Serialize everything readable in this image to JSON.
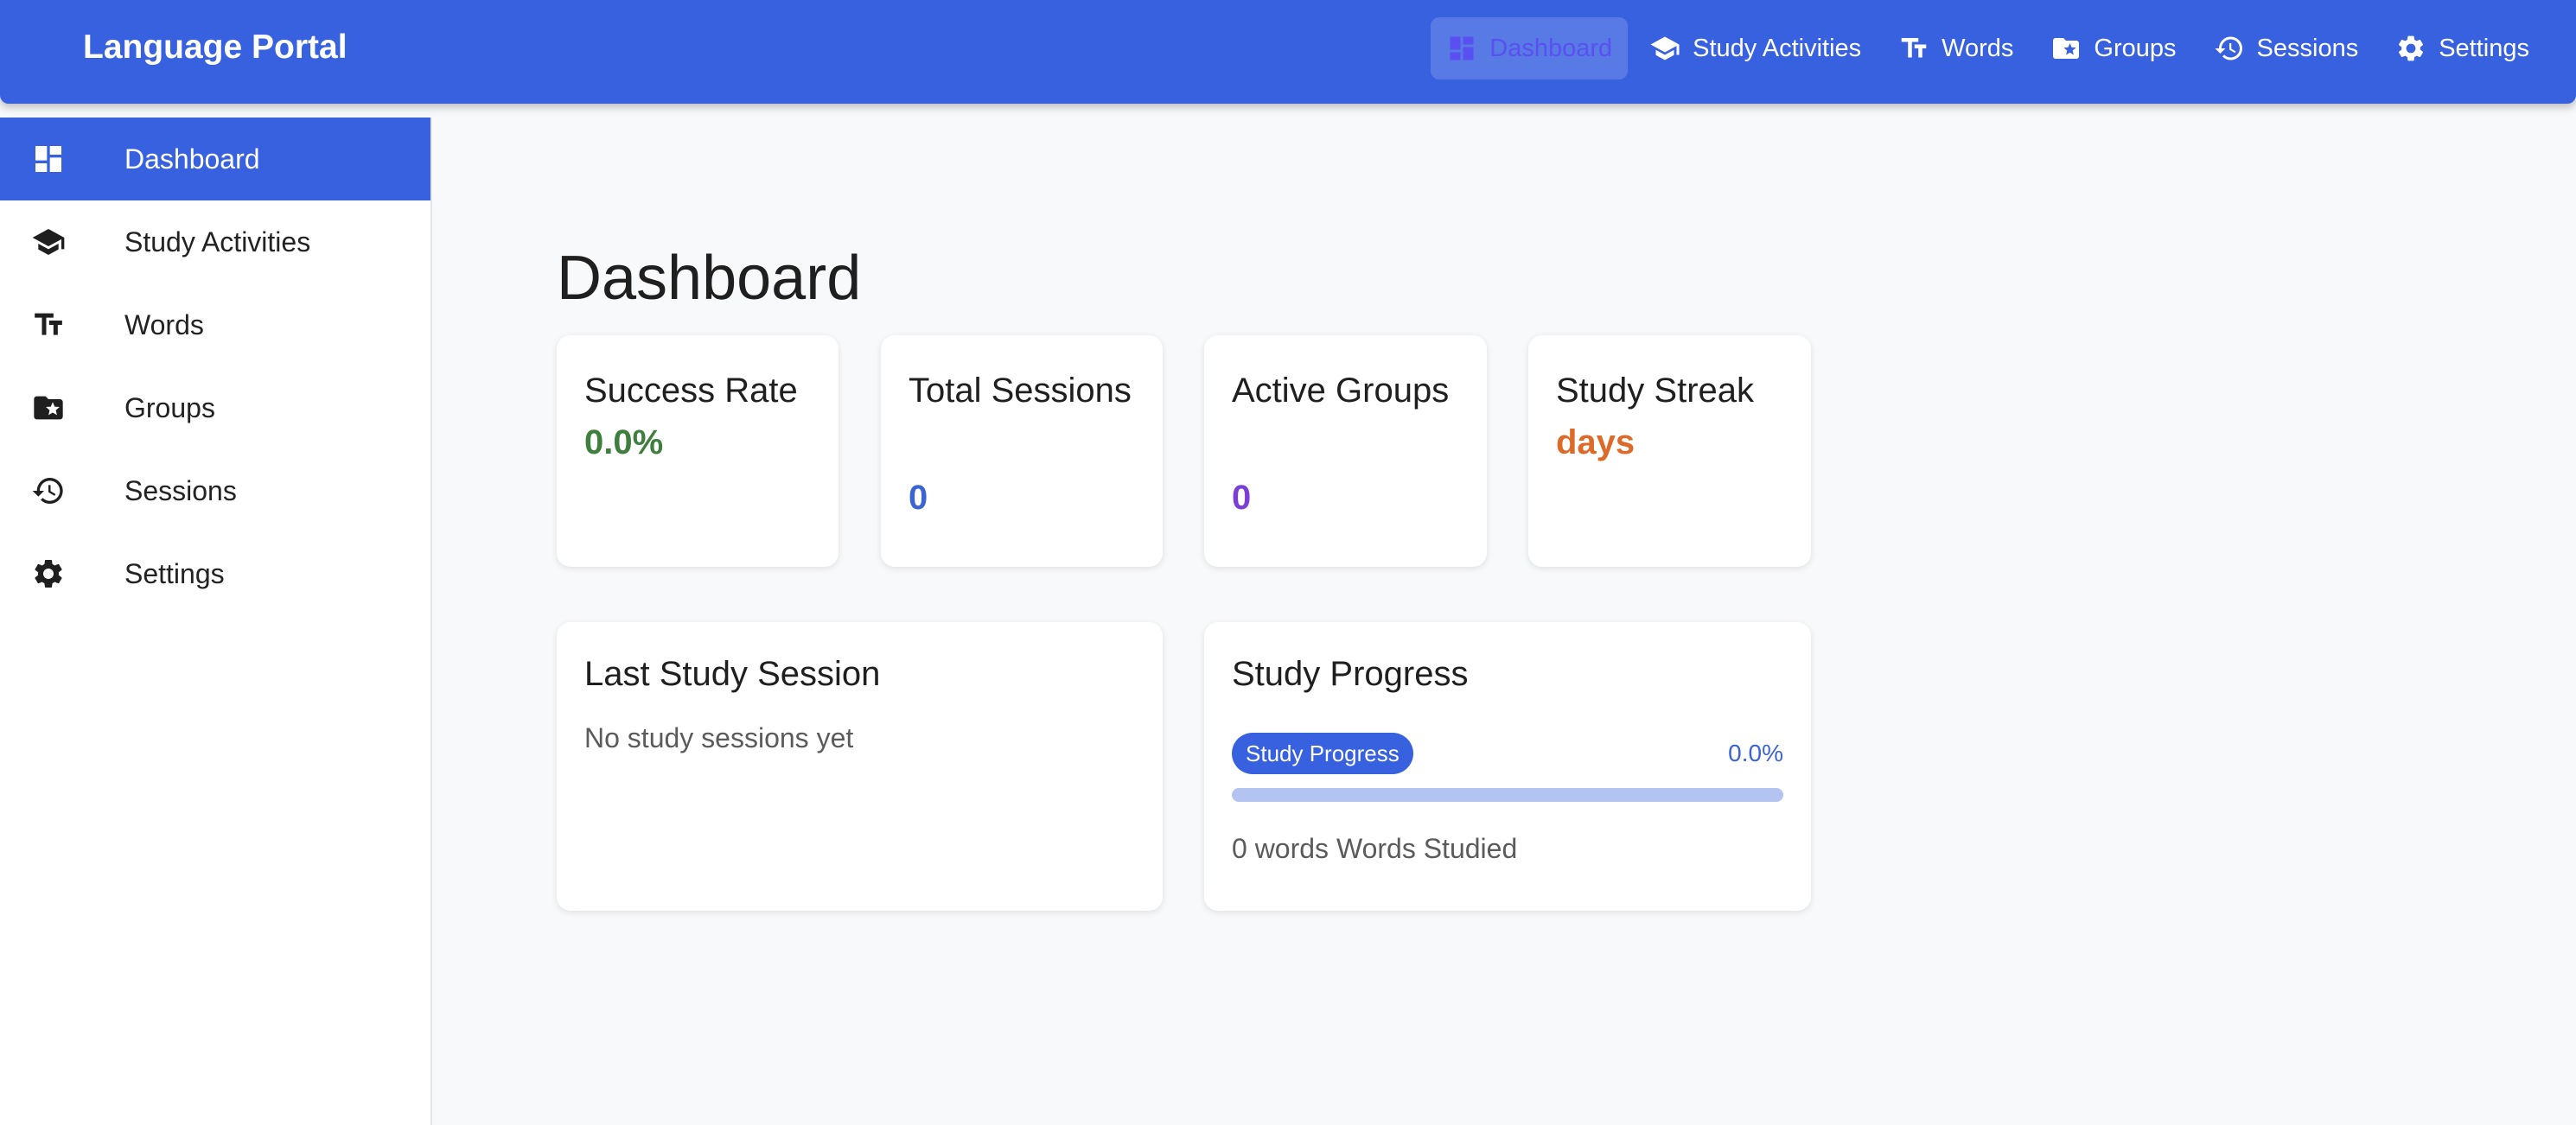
{
  "app": {
    "title": "Language Portal"
  },
  "top_nav": [
    {
      "label": "Dashboard",
      "icon": "dashboard-icon",
      "active": true
    },
    {
      "label": "Study Activities",
      "icon": "graduation-cap-icon",
      "active": false
    },
    {
      "label": "Words",
      "icon": "text-size-icon",
      "active": false
    },
    {
      "label": "Groups",
      "icon": "star-folder-icon",
      "active": false
    },
    {
      "label": "Sessions",
      "icon": "history-icon",
      "active": false
    },
    {
      "label": "Settings",
      "icon": "gear-icon",
      "active": false
    }
  ],
  "sidebar": {
    "items": [
      {
        "label": "Dashboard",
        "icon": "dashboard-icon",
        "active": true
      },
      {
        "label": "Study Activities",
        "icon": "graduation-cap-icon",
        "active": false
      },
      {
        "label": "Words",
        "icon": "text-size-icon",
        "active": false
      },
      {
        "label": "Groups",
        "icon": "star-folder-icon",
        "active": false
      },
      {
        "label": "Sessions",
        "icon": "history-icon",
        "active": false
      },
      {
        "label": "Settings",
        "icon": "gear-icon",
        "active": false
      }
    ]
  },
  "page": {
    "title": "Dashboard"
  },
  "stats": {
    "success_rate": {
      "label": "Success Rate",
      "value": "0.0%"
    },
    "total_sessions": {
      "label": "Total Sessions",
      "value": "0"
    },
    "active_groups": {
      "label": "Active Groups",
      "value": "0"
    },
    "study_streak": {
      "label": "Study Streak",
      "value": "days"
    }
  },
  "last_session": {
    "title": "Last Study Session",
    "empty_text": "No study sessions yet"
  },
  "study_progress": {
    "title": "Study Progress",
    "chip_label": "Study Progress",
    "percent_text": "0.0%",
    "progress_fraction": 0.0,
    "words_text": "0 words Words Studied"
  },
  "colors": {
    "brand": "#3861e0",
    "success": "#3e7f3e",
    "info": "#3b63d4",
    "groups": "#7b3fd8",
    "streak": "#dc6a28",
    "progress_track": "#b3c4f3"
  }
}
